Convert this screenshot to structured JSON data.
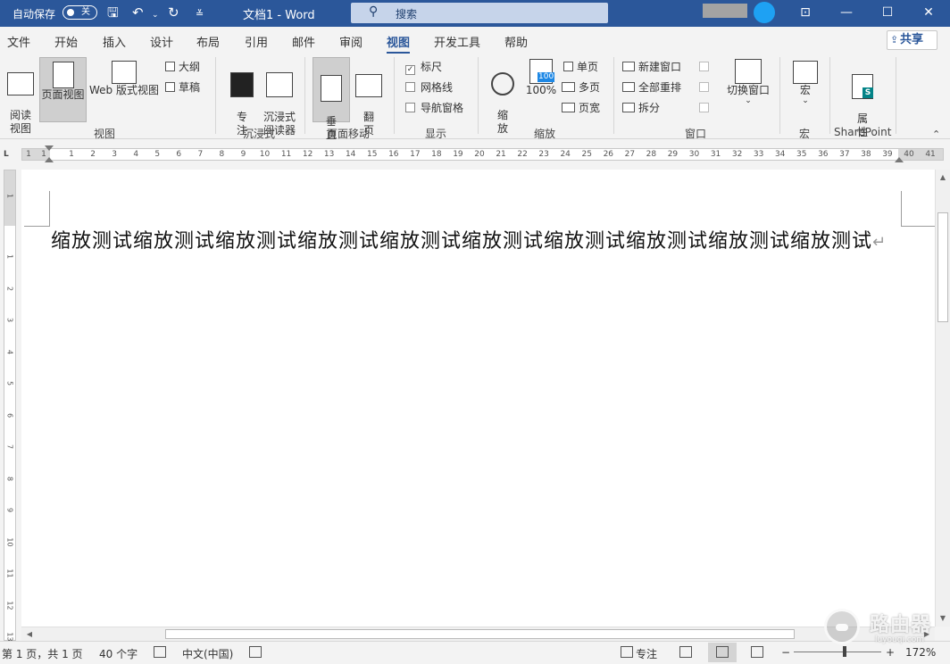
{
  "titlebar": {
    "autosave_label": "自动保存",
    "autosave_state": "关",
    "doc_title": "文档1  -  Word",
    "search_label": "搜索",
    "icons": {
      "save": "save-icon",
      "undo": "undo-icon",
      "redo": "redo-icon",
      "customize": "customize-qat-icon"
    },
    "bg_color": "#2b579a"
  },
  "menu": {
    "tabs": [
      "文件",
      "开始",
      "插入",
      "设计",
      "布局",
      "引用",
      "邮件",
      "审阅",
      "视图",
      "开发工具",
      "帮助"
    ],
    "active_tab": "视图",
    "share_label": "共享"
  },
  "ribbon": {
    "views": {
      "group_label": "视图",
      "read_mode": "阅读\n视图",
      "print_layout": "页面视图",
      "web_layout": "Web 版式视图",
      "outline": "大纲",
      "draft": "草稿"
    },
    "immersive": {
      "group_label": "沉浸式",
      "focus": "专\n注",
      "immersive_reader": "沉浸式\n阅读器"
    },
    "page_movement": {
      "group_label": "页面移动",
      "vertical": "垂\n直",
      "side_to_side": "翻\n页"
    },
    "show": {
      "group_label": "显示",
      "ruler": "标尺",
      "ruler_checked": true,
      "gridlines": "网格线",
      "gridlines_checked": false,
      "nav_pane": "导航窗格",
      "nav_pane_checked": false
    },
    "zoom": {
      "group_label": "缩放",
      "zoom": "缩\n放",
      "hundred": "100%",
      "one_page": "单页",
      "multiple_pages": "多页",
      "page_width": "页宽",
      "badge": "100"
    },
    "window": {
      "group_label": "窗口",
      "new_window": "新建窗口",
      "arrange_all": "全部重排",
      "split": "拆分",
      "switch_windows": "切换窗口"
    },
    "macros": {
      "group_label": "宏",
      "macros": "宏"
    },
    "sharepoint": {
      "group_label": "SharePoint",
      "properties": "属\n性"
    }
  },
  "ruler": {
    "corner": "L",
    "left_numbers": [
      1,
      1
    ],
    "numbers": [
      1,
      2,
      3,
      4,
      5,
      6,
      7,
      8,
      9,
      10,
      11,
      12,
      13,
      14,
      15,
      16,
      17,
      18,
      19,
      20,
      21,
      22,
      23,
      24,
      25,
      26,
      27,
      28,
      29,
      30,
      31,
      32,
      33,
      34,
      35,
      36,
      37,
      38,
      39
    ],
    "right_numbers": [
      40,
      41
    ],
    "vertical_numbers": [
      1,
      1,
      2,
      3,
      4,
      5,
      6,
      7,
      8,
      9,
      10,
      11,
      12,
      13
    ]
  },
  "document": {
    "text": "缩放测试缩放测试缩放测试缩放测试缩放测试缩放测试缩放测试缩放测试缩放测试缩放测试",
    "paragraph_mark": "↵"
  },
  "statusbar": {
    "page": "第 1 页，共 1 页",
    "words": "40 个字",
    "language": "中文(中国)",
    "focus": "专注",
    "zoom_level": "172%",
    "zoom_minus": "−",
    "zoom_plus": "+"
  },
  "watermark": {
    "name": "路由器",
    "url": "luyouqi.com"
  }
}
